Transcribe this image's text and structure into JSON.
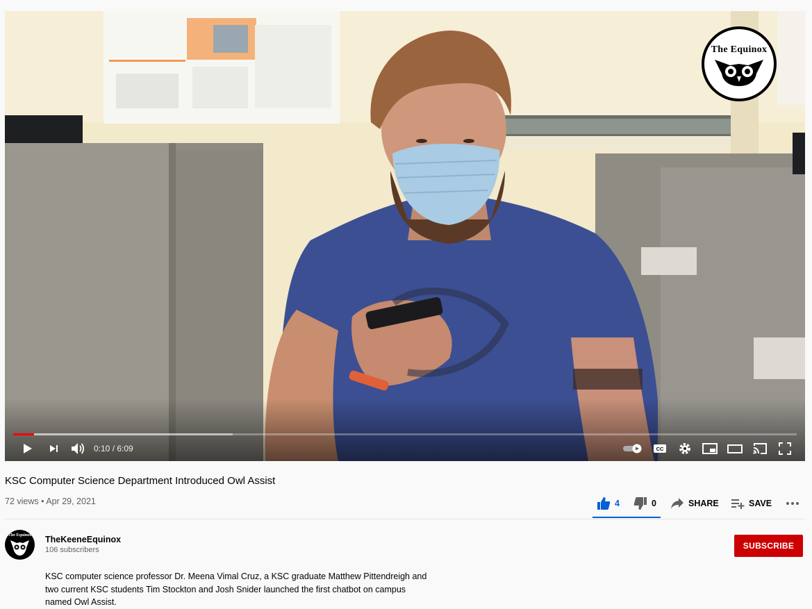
{
  "player": {
    "watermark_text": "The Equinox",
    "time_display": "0:10 / 6:09",
    "progress_fraction": 0.027,
    "buffered_fraction": 0.28
  },
  "video": {
    "title": "KSC Computer Science Department Introduced Owl Assist",
    "meta": "72 views • Apr 29, 2021"
  },
  "actions": {
    "like_count": "4",
    "dislike_count": "0",
    "share_label": "SHARE",
    "save_label": "SAVE"
  },
  "channel": {
    "avatar_text": "The Equinox",
    "name": "TheKeeneEquinox",
    "subscribers": "106 subscribers",
    "subscribe_label": "SUBSCRIBE"
  },
  "description": "KSC computer science professor Dr. Meena Vimal Cruz, a KSC graduate Matthew Pittendreigh and two current KSC students Tim Stockton and Josh Snider launched the first chatbot on campus named Owl Assist.",
  "colors": {
    "accent": "#065fd4",
    "subscribe": "#cc0000",
    "progress": "#ff0000"
  }
}
